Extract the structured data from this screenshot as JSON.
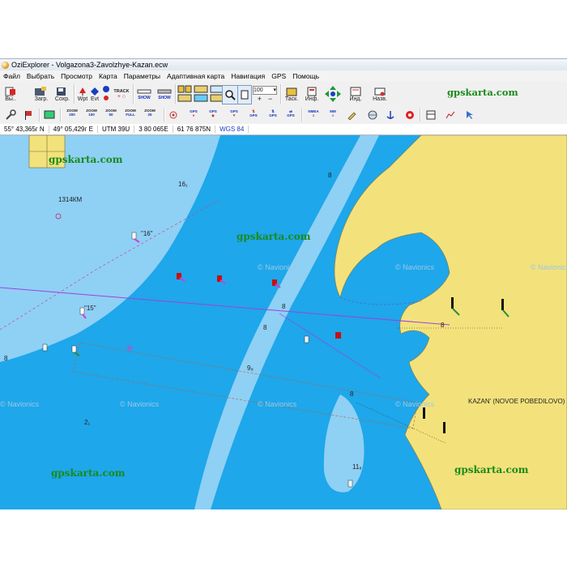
{
  "window": {
    "title": "OziExplorer - Volgazona3-Zavolzhye-Kazan.ecw"
  },
  "menu": [
    "Файл",
    "Выбрать",
    "Просмотр",
    "Карта",
    "Параметры",
    "Адаптивная карта",
    "Навигация",
    "GPS",
    "Помощь"
  ],
  "toolbar1": {
    "exit_label": "Вы..",
    "load_label": "Загр.",
    "save_label": "Сохр.",
    "wpt_label": "Wpt",
    "evt_label": "Evt",
    "track_label": "TRACK",
    "plus_minus": "+ ○",
    "show_label": "SHOW",
    "zoom_value": "100",
    "task_label": "Таск.",
    "info_label": "Инф.",
    "index_label": "Инд.",
    "name_label": "Назв.",
    "brand": "gpskarta.com"
  },
  "toolbar2": {
    "zoom_buttons": [
      {
        "top": "ZOOM",
        "bottom": "200"
      },
      {
        "top": "ZOOM",
        "bottom": "100"
      },
      {
        "top": "ZOOM",
        "bottom": "50"
      },
      {
        "top": "ZOOM",
        "bottom": "FULL"
      },
      {
        "top": "ZOOM",
        "bottom": "25"
      }
    ],
    "gps_label": "GPS",
    "nmea_label": "NMEA",
    "mm_label": "MM"
  },
  "status": {
    "lat": "55° 43,365г N",
    "lon": "49° 05,429г E",
    "utm": "UTM  39U",
    "easting": "3 80 065E",
    "northing": "61 76 875N",
    "datum": "WGS 84"
  },
  "map": {
    "watermark": "gpskarta.com",
    "faint_watermark": "© Navionics",
    "labels": {
      "km": "1314КМ",
      "kazan": "KAZAN' (NOVOE POBEDILOVO)",
      "buoy16": "\"16\"",
      "buoy15": "\"15\""
    },
    "depths": [
      "16₁",
      "8",
      "8",
      "9₈",
      "8",
      "2₁",
      "11₈",
      "8",
      "8",
      "8"
    ]
  },
  "colors": {
    "deep_water": "#1ea7ea",
    "shallow_water": "#8fd0f5",
    "land": "#f3e27b",
    "brand_green": "#1a8a1a",
    "route": "#a040e0"
  }
}
